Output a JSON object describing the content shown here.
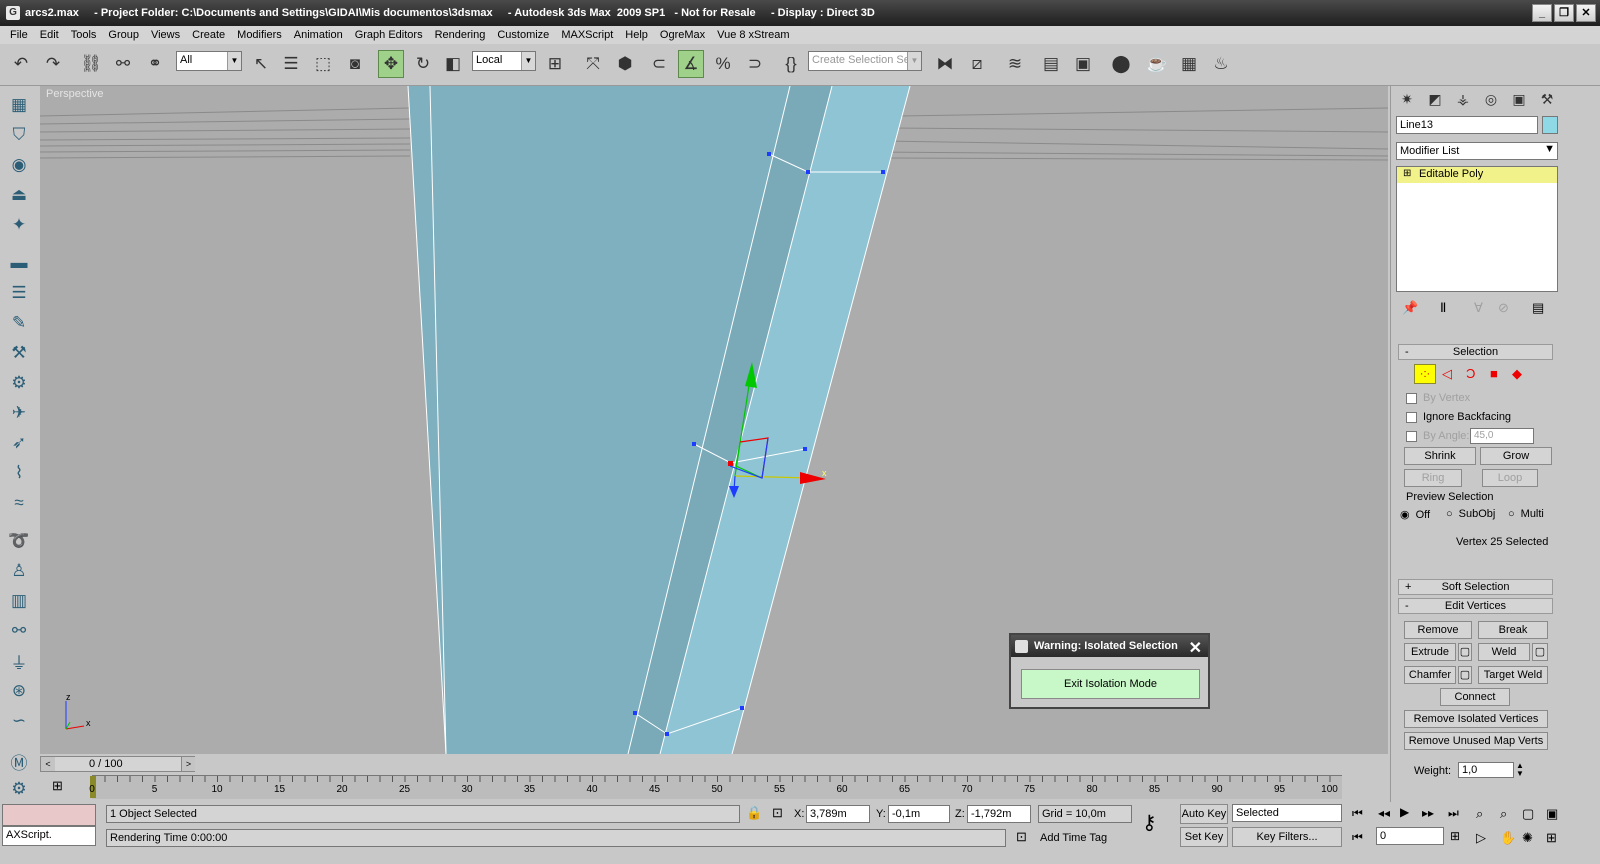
{
  "window": {
    "title": "arcs2.max     - Project Folder: C:\\Documents and Settings\\GIDAI\\Mis documentos\\3dsmax     - Autodesk 3ds Max  2009 SP1   - Not for Resale     - Display : Direct 3D",
    "minimize": "_",
    "restore": "❐",
    "close": "✕"
  },
  "menu": [
    "File",
    "Edit",
    "Tools",
    "Group",
    "Views",
    "Create",
    "Modifiers",
    "Animation",
    "Graph Editors",
    "Rendering",
    "Customize",
    "MAXScript",
    "Help",
    "OgreMax",
    "Vue 8 xStream"
  ],
  "toolbar": {
    "selection_filter": "All",
    "reference_coord": "Local",
    "named_selection_placeholder": "Create Selection Set"
  },
  "viewport": {
    "label": "Perspective",
    "axis_x": "x",
    "axis_z": "z",
    "gizmo_x": "x",
    "bg": "#acacac",
    "mesh_color": "#7fb0bf",
    "mesh_light": "#8fc4d4"
  },
  "dialog": {
    "title": "Warning: Isolated Selection",
    "close": "✕",
    "button": "Exit Isolation Mode"
  },
  "timeline": {
    "frame_display": "0 / 100",
    "ticks": [
      "0",
      "5",
      "10",
      "15",
      "20",
      "25",
      "30",
      "35",
      "40",
      "45",
      "50",
      "55",
      "60",
      "65",
      "70",
      "75",
      "80",
      "85",
      "90",
      "95",
      "100"
    ]
  },
  "status": {
    "maxscript_label": "AXScript.",
    "selected_count": "1 Object Selected",
    "rendering_time": "Rendering Time  0:00:00",
    "x_label": "X:",
    "x_value": "3,789m",
    "y_label": "Y:",
    "y_value": "-0,1m",
    "z_label": "Z:",
    "z_value": "-1,792m",
    "grid": "Grid = 10,0m",
    "add_time_tag": "Add Time Tag",
    "auto_key": "Auto Key",
    "set_key": "Set Key",
    "key_mode": "Selected",
    "key_filters": "Key Filters...",
    "current_frame": "0"
  },
  "command_panel": {
    "object_name": "Line13",
    "object_color": "#8fd8e6",
    "modifier_list": "Modifier List",
    "stack_item": "Editable Poly",
    "selection": {
      "header": "Selection",
      "header_sign": "-",
      "by_vertex": "By Vertex",
      "ignore_backfacing": "Ignore Backfacing",
      "by_angle": "By Angle:",
      "angle_value": "45,0",
      "shrink": "Shrink",
      "grow": "Grow",
      "ring": "Ring",
      "loop": "Loop",
      "preview_selection": "Preview Selection",
      "off": "Off",
      "subobj": "SubObj",
      "multi": "Multi",
      "status": "Vertex 25 Selected"
    },
    "soft_selection": {
      "header": "Soft Selection",
      "sign": "+"
    },
    "edit_vertices": {
      "header": "Edit Vertices",
      "sign": "-",
      "remove": "Remove",
      "break": "Break",
      "extrude": "Extrude",
      "weld": "Weld",
      "chamfer": "Chamfer",
      "target_weld": "Target Weld",
      "connect": "Connect",
      "remove_isolated": "Remove Isolated Vertices",
      "remove_unused": "Remove Unused Map Verts",
      "weight_label": "Weight:",
      "weight_value": "1,0"
    }
  }
}
